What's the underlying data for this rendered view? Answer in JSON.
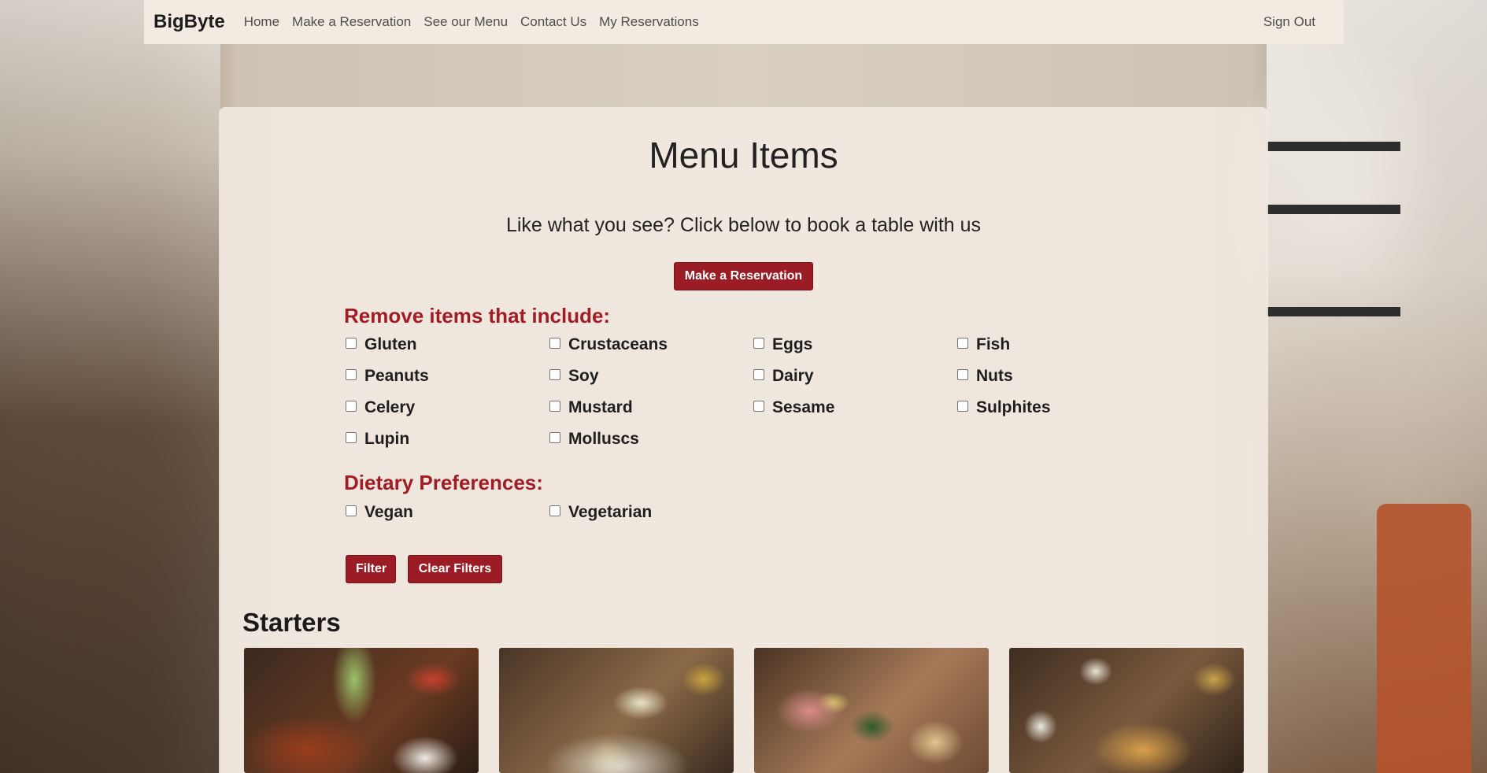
{
  "navbar": {
    "brand": "BigByte",
    "links": [
      "Home",
      "Make a Reservation",
      "See our Menu",
      "Contact Us",
      "My Reservations"
    ],
    "sign_out": "Sign Out"
  },
  "main": {
    "title": "Menu Items",
    "subtitle": "Like what you see? Click below to book a table with us",
    "reserve_button": "Make a Reservation",
    "allergen_heading": "Remove items that include:",
    "allergens": [
      "Gluten",
      "Crustaceans",
      "Eggs",
      "Fish",
      "Peanuts",
      "Soy",
      "Dairy",
      "Nuts",
      "Celery",
      "Mustard",
      "Sesame",
      "Sulphites",
      "Lupin",
      "Molluscs"
    ],
    "diet_heading": "Dietary Preferences:",
    "diets": [
      "Vegan",
      "Vegetarian"
    ],
    "filter_button": "Filter",
    "clear_button": "Clear Filters",
    "section_title": "Starters"
  },
  "colors": {
    "accent": "#9b1c24",
    "heading_red": "#a01d26",
    "navbar_bg": "#f3ebe2"
  }
}
